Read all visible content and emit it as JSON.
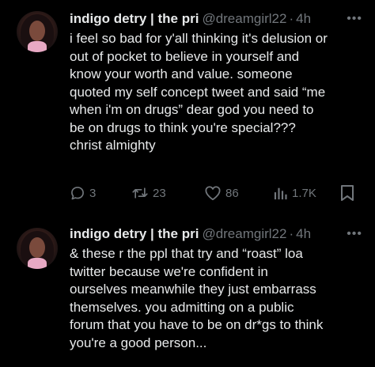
{
  "tweets": [
    {
      "display_name": "indigo detry | the pri",
      "handle": "@dreamgirl22",
      "separator": "·",
      "time": "4h",
      "more": "•••",
      "text": "i feel so bad for y'all thinking it's delusion or\nout of pocket to believe in yourself and\nknow your worth and value. someone\nquoted my self concept tweet and said “me\nwhen i'm on drugs” dear god you need to\nbe on drugs to think you're special???\nchrist almighty",
      "actions": {
        "replies": "3",
        "reposts": "23",
        "likes": "86",
        "views": "1.7K"
      }
    },
    {
      "display_name": "indigo detry | the pri",
      "handle": "@dreamgirl22",
      "separator": "·",
      "time": "4h",
      "more": "•••",
      "text": "& these r the ppl that try and “roast” loa\ntwitter because we're confident in\nourselves meanwhile they just embarrass\nthemselves. you admitting on a public\nforum that you have to be on dr*gs to think\nyou're a good person..."
    }
  ],
  "icons": {
    "reply": "reply-icon",
    "repost": "repost-icon",
    "like": "heart-icon",
    "views": "views-icon",
    "bookmark": "bookmark-icon"
  },
  "colors": {
    "background": "#000000",
    "text_primary": "#e7e9ea",
    "text_secondary": "#71767b"
  }
}
